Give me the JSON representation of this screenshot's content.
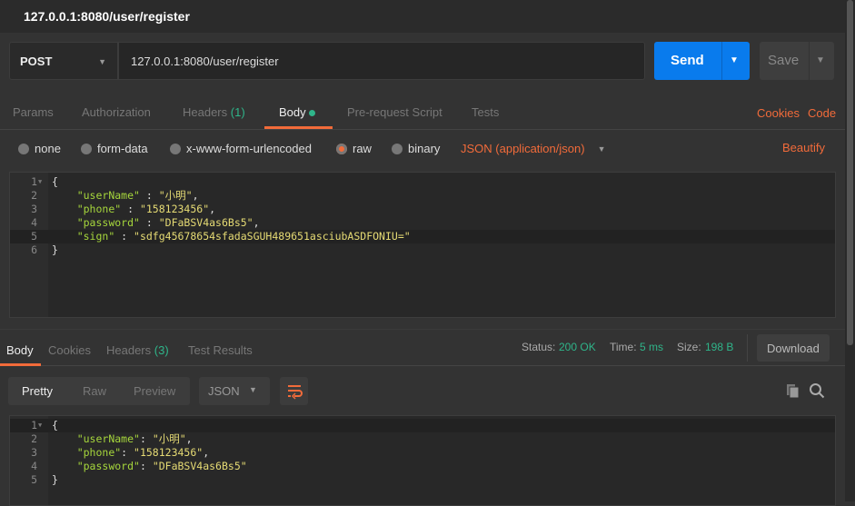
{
  "window": {
    "title": "127.0.0.1:8080/user/register"
  },
  "request": {
    "method": "POST",
    "url": "127.0.0.1:8080/user/register",
    "send_label": "Send",
    "save_label": "Save"
  },
  "request_tabs": [
    {
      "label": "Params"
    },
    {
      "label": "Authorization"
    },
    {
      "label": "Headers",
      "count": "(1)"
    },
    {
      "label": "Body",
      "active": true
    },
    {
      "label": "Pre-request Script"
    },
    {
      "label": "Tests"
    }
  ],
  "request_links": {
    "cookies": "Cookies",
    "code": "Code"
  },
  "body_types": [
    {
      "label": "none"
    },
    {
      "label": "form-data"
    },
    {
      "label": "x-www-form-urlencoded"
    },
    {
      "label": "raw",
      "selected": true
    },
    {
      "label": "binary"
    }
  ],
  "content_type": "JSON (application/json)",
  "beautify": "Beautify",
  "request_body": [
    [
      "1",
      "{",
      "",
      ""
    ],
    [
      "2",
      "",
      "\"userName\"",
      " : ",
      "\"小明\"",
      ","
    ],
    [
      "3",
      "",
      "\"phone\"",
      " : ",
      "\"158123456\"",
      ","
    ],
    [
      "4",
      "",
      "\"password\"",
      " : ",
      "\"DFaBSV4as6Bs5\"",
      ","
    ],
    [
      "5",
      "",
      "\"sign\"",
      " : ",
      "\"sdfg45678654sfadaSGUH489651asciubASDFONIU=\"",
      ""
    ],
    [
      "6",
      "}",
      "",
      ""
    ]
  ],
  "response_tabs": [
    {
      "label": "Body",
      "active": true
    },
    {
      "label": "Cookies"
    },
    {
      "label": "Headers",
      "count": "(3)"
    },
    {
      "label": "Test Results"
    }
  ],
  "response_meta": {
    "status_label": "Status:",
    "status": "200 OK",
    "time_label": "Time:",
    "time": "5 ms",
    "size_label": "Size:",
    "size": "198 B",
    "download": "Download"
  },
  "response_view": {
    "modes": [
      "Pretty",
      "Raw",
      "Preview"
    ],
    "format": "JSON"
  },
  "response_body": [
    [
      "1",
      "{",
      "",
      ""
    ],
    [
      "2",
      "",
      "\"userName\"",
      ": ",
      "\"小明\"",
      ","
    ],
    [
      "3",
      "",
      "\"phone\"",
      ": ",
      "\"158123456\"",
      ","
    ],
    [
      "4",
      "",
      "\"password\"",
      ": ",
      "\"DFaBSV4as6Bs5\"",
      ""
    ],
    [
      "5",
      "}",
      "",
      ""
    ]
  ],
  "colors": {
    "accent": "#f26b3a",
    "send": "#097bed",
    "success": "#2fb58a",
    "key": "#a6d63c",
    "string": "#e6db74"
  }
}
